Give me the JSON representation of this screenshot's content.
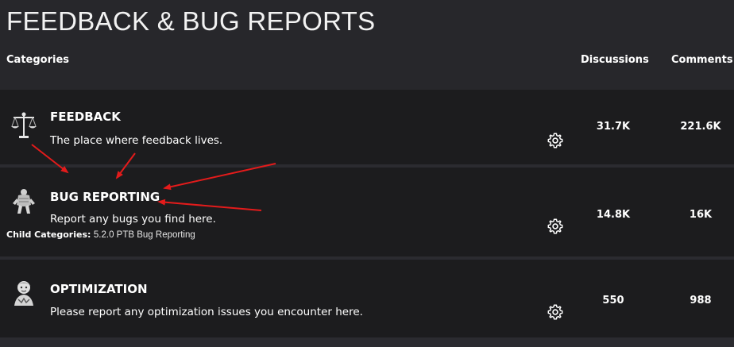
{
  "page": {
    "title": "FEEDBACK & BUG REPORTS"
  },
  "headers": {
    "categories": "Categories",
    "discussions": "Discussions",
    "comments": "Comments"
  },
  "categories": [
    {
      "name": "FEEDBACK",
      "description": "The place where feedback lives.",
      "discussions": "31.7K",
      "comments": "221.6K",
      "icon": "scales-icon"
    },
    {
      "name": "BUG REPORTING",
      "description": "Report any bugs you find here.",
      "child_label": "Child Categories:",
      "child_link": "5.2.0 PTB Bug Reporting",
      "discussions": "14.8K",
      "comments": "16K",
      "icon": "creature-icon"
    },
    {
      "name": "OPTIMIZATION",
      "description": "Please report any optimization issues you encounter here.",
      "discussions": "550",
      "comments": "988",
      "icon": "character-icon"
    }
  ],
  "colors": {
    "background": "#27272b",
    "row_background": "#1c1c1e",
    "annotation_arrow": "#e31b1b"
  }
}
